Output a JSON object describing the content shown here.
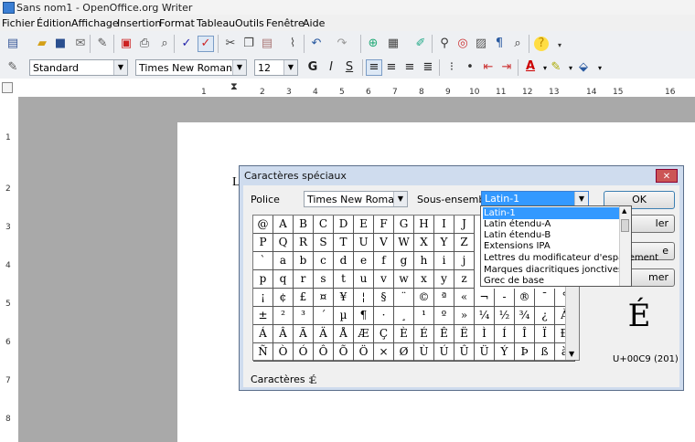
{
  "window": {
    "title": "Sans nom1 - OpenOffice.org Writer"
  },
  "menu": [
    "Fichier",
    "Édition",
    "Affichage",
    "Insertion",
    "Format",
    "Tableau",
    "Outils",
    "Fenêtre",
    "Aide"
  ],
  "format_bar": {
    "style": "Standard",
    "font": "Times New Roman",
    "size": "12"
  },
  "ruler": {
    "marks": [
      "1",
      "2",
      "3",
      "4",
      "5",
      "6",
      "7",
      "8",
      "9",
      "10",
      "11",
      "12",
      "13",
      "14",
      "15",
      "16"
    ]
  },
  "vruler": {
    "marks": [
      "1",
      "2",
      "3",
      "4",
      "5",
      "6",
      "7",
      "8"
    ]
  },
  "dialog": {
    "title": "Caractères spéciaux",
    "police_label": "Police",
    "police_value": "Times New Roman",
    "subset_label": "Sous-ensemble",
    "subset_value": "Latin-1",
    "ok_label": "OK",
    "cancel_label": "ler",
    "help_label": "e",
    "delete_label": "mer",
    "preview_char": "É",
    "code": "U+00C9 (201)",
    "chars_label": "Caractères :",
    "chars_value": "É",
    "dropdown_items": [
      "Latin-1",
      "Latin étendu-A",
      "Latin étendu-B",
      "Extensions IPA",
      "Lettres du modificateur d'espacement",
      "Marques diacritiques jonctives",
      "Grec de base"
    ],
    "grid": [
      [
        "@",
        "A",
        "B",
        "C",
        "D",
        "E",
        "F",
        "G",
        "H",
        "I",
        "J"
      ],
      [
        "P",
        "Q",
        "R",
        "S",
        "T",
        "U",
        "V",
        "W",
        "X",
        "Y",
        "Z"
      ],
      [
        "`",
        "a",
        "b",
        "c",
        "d",
        "e",
        "f",
        "g",
        "h",
        "i",
        "j"
      ],
      [
        "p",
        "q",
        "r",
        "s",
        "t",
        "u",
        "v",
        "w",
        "x",
        "y",
        "z"
      ],
      [
        "¡",
        "¢",
        "£",
        "¤",
        "¥",
        "¦",
        "§",
        "¨",
        "©",
        "ª",
        "«",
        "¬",
        "-",
        "®",
        "¯",
        "°"
      ],
      [
        "±",
        "²",
        "³",
        "´",
        "µ",
        "¶",
        "·",
        "¸",
        "¹",
        "º",
        "»",
        "¼",
        "½",
        "¾",
        "¿",
        "À"
      ],
      [
        "Á",
        "Â",
        "Ã",
        "Ä",
        "Å",
        "Æ",
        "Ç",
        "È",
        "É",
        "Ê",
        "Ë",
        "Ì",
        "Í",
        "Î",
        "Ï",
        "Ð"
      ],
      [
        "Ñ",
        "Ò",
        "Ó",
        "Ô",
        "Õ",
        "Ö",
        "×",
        "Ø",
        "Ù",
        "Ú",
        "Û",
        "Ü",
        "Ý",
        "Þ",
        "ß",
        "à"
      ]
    ]
  },
  "doc": {
    "visible_char": "L"
  }
}
